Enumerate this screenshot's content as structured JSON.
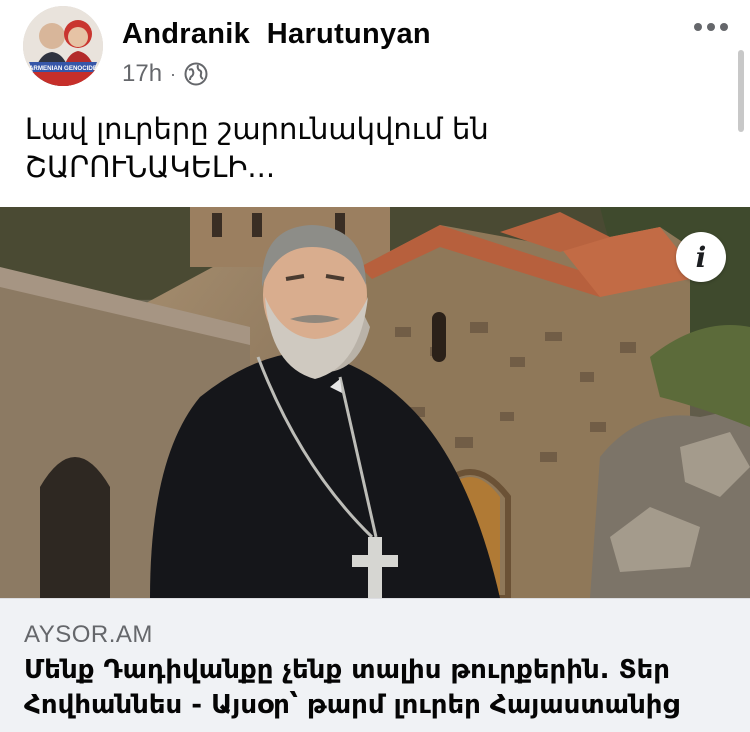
{
  "post": {
    "author": "Andranik  Harutunyan",
    "timestamp": "17h",
    "separator": "·",
    "privacy_icon": "globe-icon",
    "more_icon": "more-options-icon",
    "text_lines": [
      "Լավ լուրերը շարունակվում են",
      "ՇԱՐՈՒՆԱԿԵԼԻ..."
    ],
    "avatar": {
      "banner_text": "ARMENIAN GENOCIDE"
    }
  },
  "image": {
    "info_label": "i",
    "info_icon": "info-icon"
  },
  "link_preview": {
    "domain": "AYSOR.AM",
    "title_lines": [
      "Մենք Դադիվանքը չենք տալիս թուրքերին. Տեր",
      "Հովհաննես - Այսօր՝ թարմ լուրեր Հայաստանից"
    ]
  },
  "colors": {
    "secondary_text": "#65676b",
    "link_background": "#f0f2f5",
    "primary_text": "#050505"
  }
}
